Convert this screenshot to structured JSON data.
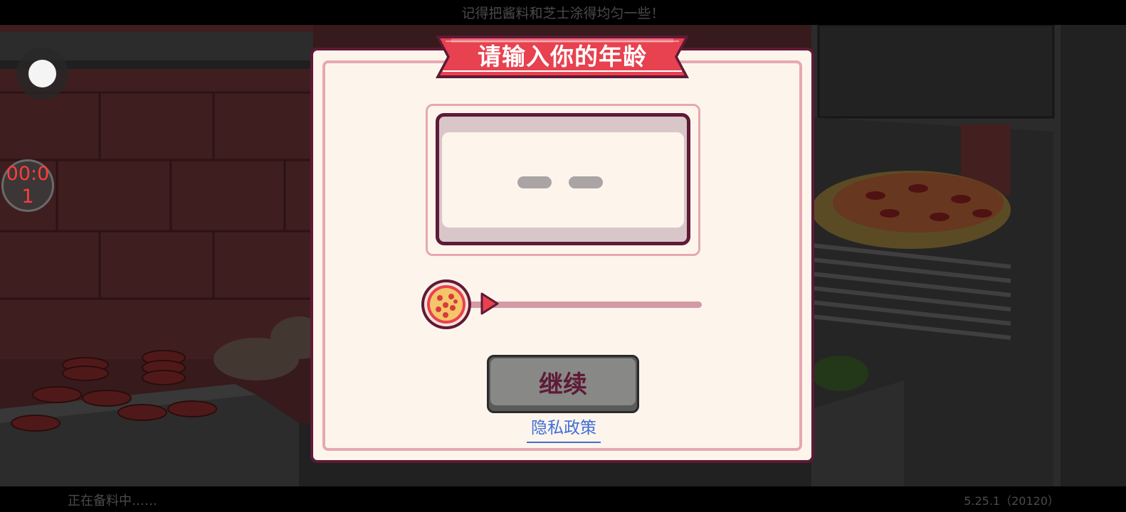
{
  "app": {
    "hint_text": "记得把酱料和芝士涂得均匀一些！",
    "loading_text": "正在备料中……",
    "version_text": "5.25.1（20120）"
  },
  "overlay": {
    "timer_text": "00:01",
    "floating_button_icon": "assistive-touch-icon"
  },
  "dialog": {
    "title": "请输入你的年龄",
    "age_value": "",
    "age_placeholder_icon": "two-dash-placeholder",
    "slider_level": 0,
    "slider_handle_icon": "pizza-icon",
    "slider_arrow_icon": "play-arrow-icon",
    "continue_label": "继续",
    "privacy_label": "隐私政策"
  },
  "colors": {
    "dialog_bg": "#fdf5ec",
    "dialog_border": "#5e1a36",
    "ribbon_red": "#e8414f",
    "accent_pink": "#e6a8b2",
    "button_gray": "#888887",
    "link_blue": "#3f6fd6",
    "timer_red": "#ff3d3d"
  }
}
